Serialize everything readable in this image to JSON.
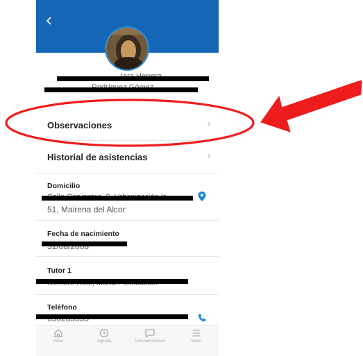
{
  "header": {
    "back_icon": "chevron-left-icon"
  },
  "profile": {
    "name_line1": "Iara Herrera",
    "name_line2": "Rodríguez Gómez"
  },
  "rows": [
    {
      "label": "Observaciones",
      "chevron": "›"
    },
    {
      "label": "Historial de asistencias",
      "chevron": "›"
    }
  ],
  "fields": {
    "domicilio": {
      "label": "Domicilio",
      "value_line1": "Calle Cervantes, 9, Urbanización la",
      "value_line2": "51, Mairena del Alcor"
    },
    "nacimiento": {
      "label": "Fecha de nacimiento",
      "value": "31/08/2008"
    },
    "tutor": {
      "label": "Tutor 1",
      "value": "Romero Ruíz, María Purificación"
    },
    "telefono": {
      "label": "Teléfono",
      "value": "650283333"
    }
  },
  "bottom_nav": [
    {
      "label": "Inicio",
      "icon": "home-icon"
    },
    {
      "label": "Agenda",
      "icon": "clock-icon"
    },
    {
      "label": "Comunicaciones",
      "icon": "chat-icon"
    },
    {
      "label": "Menú",
      "icon": "menu-icon"
    }
  ],
  "annotation": {
    "color": "#ee1c1c"
  }
}
